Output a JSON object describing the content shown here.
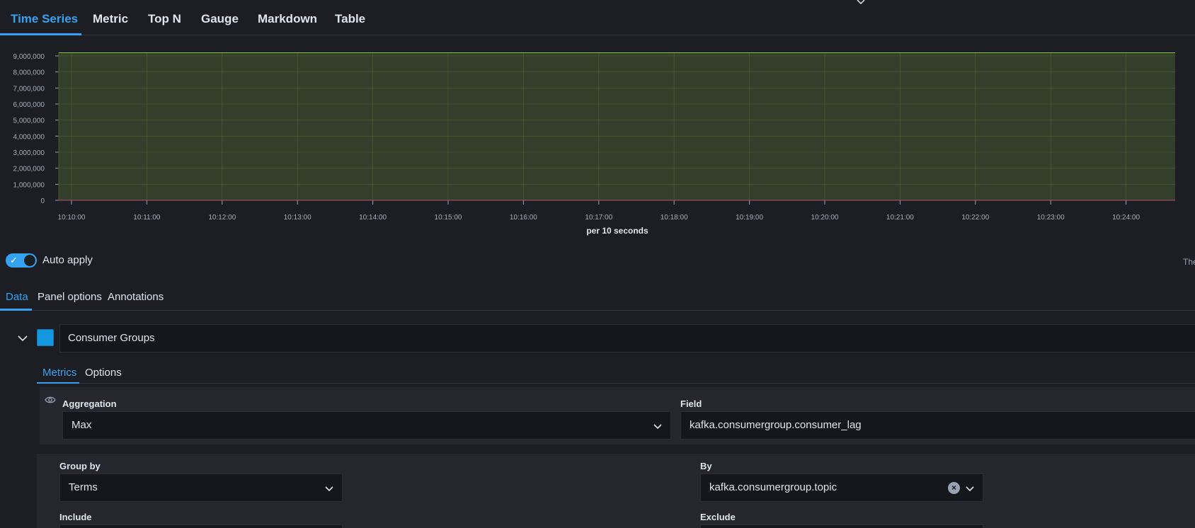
{
  "viz_tabs": [
    {
      "label": "Time Series",
      "active": true
    },
    {
      "label": "Metric",
      "active": false
    },
    {
      "label": "Top N",
      "active": false
    },
    {
      "label": "Gauge",
      "active": false
    },
    {
      "label": "Markdown",
      "active": false
    },
    {
      "label": "Table",
      "active": false
    }
  ],
  "chart": {
    "y_ticks": [
      "9,000,000",
      "8,000,000",
      "7,000,000",
      "6,000,000",
      "5,000,000",
      "4,000,000",
      "3,000,000",
      "2,000,000",
      "1,000,000",
      "0"
    ],
    "x_ticks": [
      "10:10:00",
      "10:11:00",
      "10:12:00",
      "10:13:00",
      "10:14:00",
      "10:15:00",
      "10:16:00",
      "10:17:00",
      "10:18:00",
      "10:19:00",
      "10:20:00",
      "10:21:00",
      "10:22:00",
      "10:23:00",
      "10:24:00"
    ],
    "interval_label": "per 10 seconds"
  },
  "chart_data": {
    "type": "area",
    "x": [
      "10:10:00",
      "10:11:00",
      "10:12:00",
      "10:13:00",
      "10:14:00",
      "10:15:00",
      "10:16:00",
      "10:17:00",
      "10:18:00",
      "10:19:00",
      "10:20:00",
      "10:21:00",
      "10:22:00",
      "10:23:00",
      "10:24:00"
    ],
    "series": [
      {
        "values": [
          9200000,
          9200000,
          9200000,
          9200000,
          9200000,
          9200000,
          9200000,
          9200000,
          9200000,
          9200000,
          9200000,
          9200000,
          9200000,
          9200000,
          9200000
        ],
        "color": "#8bc34a"
      }
    ],
    "xlabel": "per 10 seconds",
    "ylabel": "",
    "ylim": [
      0,
      9000000
    ],
    "grid": true
  },
  "auto_apply": {
    "label": "Auto apply",
    "enabled": true
  },
  "truncated_right_text": "The",
  "editor_tabs": [
    {
      "label": "Data",
      "active": true
    },
    {
      "label": "Panel options",
      "active": false
    },
    {
      "label": "Annotations",
      "active": false
    }
  ],
  "series": {
    "label": "Consumer Groups",
    "color": "#1496e0",
    "inner_tabs": [
      {
        "label": "Metrics",
        "active": true
      },
      {
        "label": "Options",
        "active": false
      }
    ],
    "metric": {
      "aggregation_label": "Aggregation",
      "aggregation_value": "Max",
      "field_label": "Field",
      "field_value": "kafka.consumergroup.consumer_lag"
    },
    "group": {
      "group_by_label": "Group by",
      "group_by_value": "Terms",
      "by_label": "By",
      "by_value": "kafka.consumergroup.topic",
      "include_label": "Include",
      "exclude_label": "Exclude"
    }
  },
  "icons": {
    "collapse": "chevron-down-icon",
    "visibility": "eye-icon",
    "clear": "clear-icon",
    "dropdown": "chevron-down-icon",
    "toggle_check": "check-icon"
  }
}
